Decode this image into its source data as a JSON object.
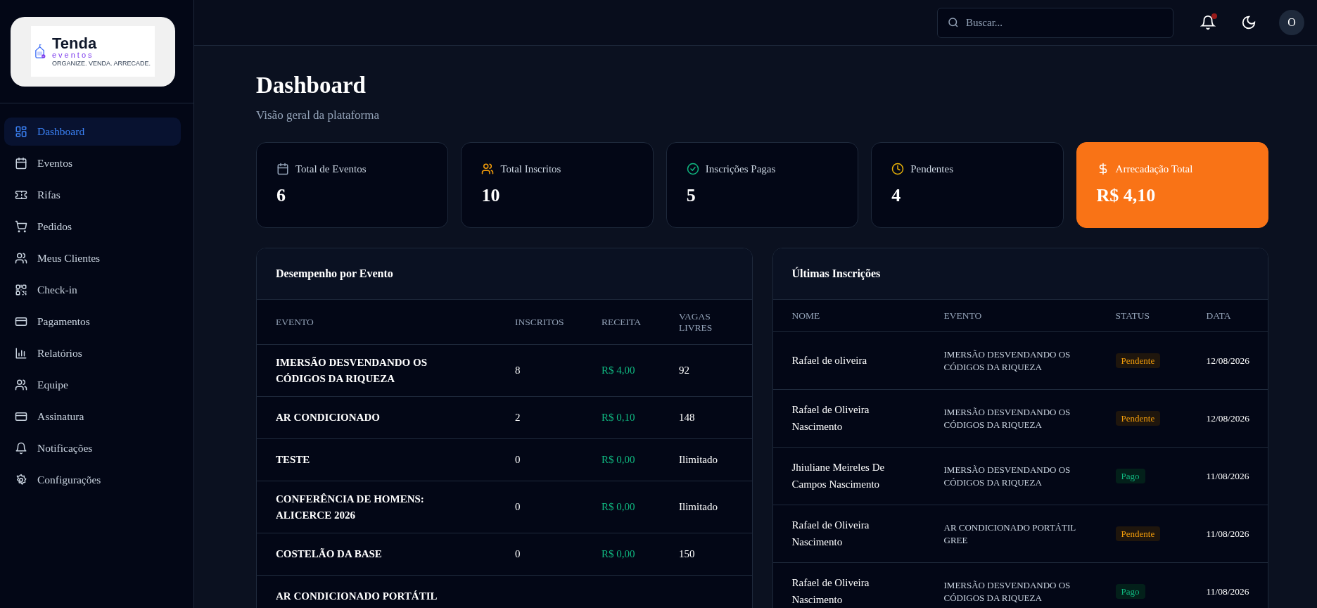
{
  "logo": {
    "name": "Tenda",
    "sub": "eventos",
    "tagline": "ORGANIZE. VENDA. ARRECADE."
  },
  "sidebar": {
    "items": [
      {
        "label": "Dashboard",
        "kind": "grid",
        "selected": true
      },
      {
        "label": "Eventos",
        "kind": "calendar",
        "selected": false
      },
      {
        "label": "Rifas",
        "kind": "ticket",
        "selected": false
      },
      {
        "label": "Pedidos",
        "kind": "cart",
        "selected": false
      },
      {
        "label": "Meus Clientes",
        "kind": "users",
        "selected": false
      },
      {
        "label": "Check-in",
        "kind": "qr",
        "selected": false
      },
      {
        "label": "Pagamentos",
        "kind": "card",
        "selected": false
      },
      {
        "label": "Relatórios",
        "kind": "chart",
        "selected": false
      },
      {
        "label": "Equipe",
        "kind": "users",
        "selected": false
      },
      {
        "label": "Assinatura",
        "kind": "card",
        "selected": false
      },
      {
        "label": "Notificações",
        "kind": "bell",
        "selected": false
      },
      {
        "label": "Configurações",
        "kind": "gear",
        "selected": false
      }
    ]
  },
  "topbar": {
    "search": {
      "placeholder": "Buscar..."
    },
    "notification_dot": true,
    "avatar": "O"
  },
  "page": {
    "title": "Dashboard",
    "subtitle": "Visão geral da plataforma"
  },
  "stats": [
    {
      "label": "Total de Eventos",
      "value": "6",
      "kind": "calendar",
      "color": "#94a3b8",
      "highlight": false
    },
    {
      "label": "Total Inscritos",
      "value": "10",
      "kind": "users",
      "color": "#f59e0b",
      "highlight": false
    },
    {
      "label": "Inscrições Pagas",
      "value": "5",
      "kind": "check",
      "color": "#10b981",
      "highlight": false
    },
    {
      "label": "Pendentes",
      "value": "4",
      "kind": "clock",
      "color": "#eab308",
      "highlight": false
    },
    {
      "label": "Arrecadação Total",
      "value": "R$ 4,10",
      "kind": "dollar",
      "color": "#ffffff",
      "highlight": true
    }
  ],
  "performance": {
    "title": "Desempenho por Evento",
    "columns": [
      "EVENTO",
      "INSCRITOS",
      "RECEITA",
      "VAGAS LIVRES"
    ],
    "rows": [
      {
        "evento": "IMERSÃO DESVENDANDO OS CÓDIGOS DA RIQUEZA",
        "inscritos": "8",
        "receita": "R$ 4,00",
        "vagas": "92"
      },
      {
        "evento": "AR CONDICIONADO",
        "inscritos": "2",
        "receita": "R$ 0,10",
        "vagas": "148"
      },
      {
        "evento": "TESTE",
        "inscritos": "0",
        "receita": "R$ 0,00",
        "vagas": "Ilimitado"
      },
      {
        "evento": "CONFERÊNCIA DE HOMENS: ALICERCE 2026",
        "inscritos": "0",
        "receita": "R$ 0,00",
        "vagas": "Ilimitado"
      },
      {
        "evento": "COSTELÃO DA BASE",
        "inscritos": "0",
        "receita": "R$ 0,00",
        "vagas": "150"
      },
      {
        "evento": "AR CONDICIONADO PORTÁTIL",
        "inscritos": "",
        "receita": "",
        "vagas": ""
      }
    ]
  },
  "recent": {
    "title": "Últimas Inscrições",
    "columns": [
      "NOME",
      "EVENTO",
      "STATUS",
      "DATA"
    ],
    "rows": [
      {
        "nome": "Rafael de oliveira",
        "evento": "IMERSÃO DESVENDANDO OS CÓDIGOS DA RIQUEZA",
        "status": "Pendente",
        "kind": "pending",
        "data": "12/08/2026"
      },
      {
        "nome": "Rafael de Oliveira Nascimento",
        "evento": "IMERSÃO DESVENDANDO OS CÓDIGOS DA RIQUEZA",
        "status": "Pendente",
        "kind": "pending",
        "data": "12/08/2026"
      },
      {
        "nome": "Jhiuliane Meireles De Campos Nascimento",
        "evento": "IMERSÃO DESVENDANDO OS CÓDIGOS DA RIQUEZA",
        "status": "Pago",
        "kind": "paid",
        "data": "11/08/2026"
      },
      {
        "nome": "Rafael de Oliveira Nascimento",
        "evento": "AR CONDICIONADO PORTÁTIL GREE",
        "status": "Pendente",
        "kind": "pending",
        "data": "11/08/2026"
      },
      {
        "nome": "Rafael de Oliveira Nascimento",
        "evento": "IMERSÃO DESVENDANDO OS CÓDIGOS DA RIQUEZA",
        "status": "Pago",
        "kind": "paid",
        "data": "11/08/2026"
      }
    ]
  }
}
